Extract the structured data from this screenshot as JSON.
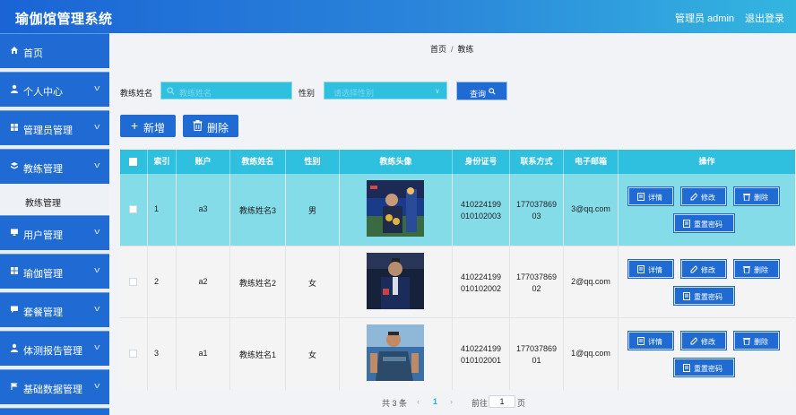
{
  "app": {
    "title": "瑜伽馆管理系统",
    "user": "管理员 admin",
    "logout": "退出登录"
  },
  "sidebar": {
    "items": [
      {
        "label": "首页",
        "icon": "home-icon",
        "arrow": false
      },
      {
        "label": "个人中心",
        "icon": "user-icon",
        "arrow": true
      },
      {
        "label": "管理员管理",
        "icon": "grid-icon",
        "arrow": true
      },
      {
        "label": "教练管理",
        "icon": "stack-icon",
        "arrow": true
      },
      {
        "label": "用户管理",
        "icon": "monitor-icon",
        "arrow": true
      },
      {
        "label": "瑜伽管理",
        "icon": "grid-icon",
        "arrow": true
      },
      {
        "label": "套餐管理",
        "icon": "chat-icon",
        "arrow": true
      },
      {
        "label": "体测报告管理",
        "icon": "user-icon",
        "arrow": true
      },
      {
        "label": "基础数据管理",
        "icon": "flag-icon",
        "arrow": true
      }
    ],
    "submenu": "教练管理"
  },
  "breadcrumb": {
    "home": "首页",
    "sep": "/",
    "current": "教练"
  },
  "search": {
    "name_label": "教练姓名",
    "name_placeholder": "教练姓名",
    "gender_label": "性别",
    "gender_placeholder": "请选择性别",
    "query_button": "查询"
  },
  "actions": {
    "add": "新增",
    "delete": "删除"
  },
  "table": {
    "headers": [
      "索引",
      "账户",
      "教练姓名",
      "性别",
      "教练头像",
      "身份证号",
      "联系方式",
      "电子邮箱",
      "操作"
    ],
    "rows": [
      {
        "index": "1",
        "account": "a3",
        "name": "教练姓名3",
        "gender": "男",
        "id_line1": "410224199",
        "id_line2": "010102003",
        "phone_line1": "177037869",
        "phone_line2": "03",
        "email": "3@qq.com"
      },
      {
        "index": "2",
        "account": "a2",
        "name": "教练姓名2",
        "gender": "女",
        "id_line1": "410224199",
        "id_line2": "010102002",
        "phone_line1": "177037869",
        "phone_line2": "02",
        "email": "2@qq.com"
      },
      {
        "index": "3",
        "account": "a1",
        "name": "教练姓名1",
        "gender": "女",
        "id_line1": "410224199",
        "id_line2": "010102001",
        "phone_line1": "177037869",
        "phone_line2": "01",
        "email": "1@qq.com"
      }
    ],
    "ops": {
      "detail": "详情",
      "edit": "修改",
      "delete": "删除",
      "reset": "重置密码"
    }
  },
  "pagination": {
    "total": "共 3 条",
    "prev": "‹",
    "current": "1",
    "next": "›",
    "goto": "前往",
    "page_value": "1",
    "page_unit": "页"
  },
  "colors": {
    "brand": "#1f6bd3",
    "accent": "#2fc0e0",
    "selected_row": "#85dce9"
  }
}
